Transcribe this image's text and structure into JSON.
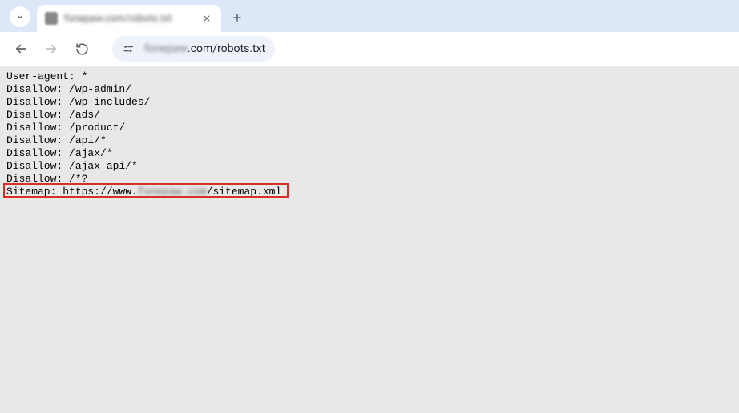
{
  "tab": {
    "title": "fonepaw.com/robots.txt"
  },
  "address": {
    "domain_blurred": "fonepaw",
    "path": ".com/robots.txt"
  },
  "robots": {
    "lines": [
      "User-agent: *",
      "Disallow: /wp-admin/",
      "Disallow: /wp-includes/",
      "Disallow: /ads/",
      "Disallow: /product/",
      "Disallow: /api/*",
      "Disallow: /ajax/*",
      "Disallow: /ajax-api/*",
      "Disallow: /*?"
    ],
    "sitemap_prefix": "Sitemap: https://www.",
    "sitemap_blurred": "fonepaw.com",
    "sitemap_suffix": "/sitemap.xml"
  }
}
